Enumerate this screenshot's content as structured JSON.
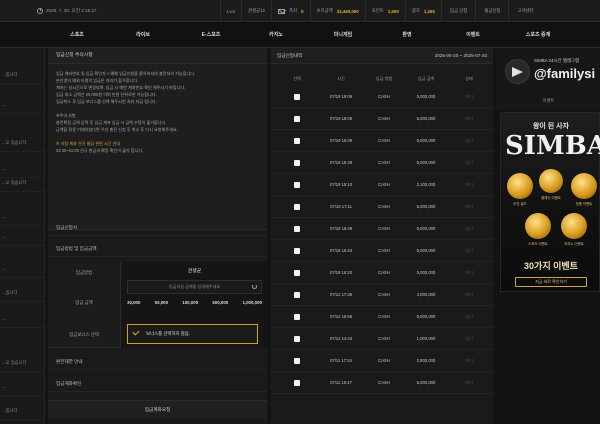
{
  "topbar": {
    "datetime": "2025. 7. 20. 오전 2:15:27",
    "level": "Lv.8",
    "username": "관생균12",
    "message_label": "쪽지",
    "message_count": "0",
    "money_label": "보유금액",
    "money_value": "23,450,000",
    "point_label": "포인트",
    "point_value": "1,000",
    "comp_label": "콤프",
    "comp_value": "1,250",
    "deposit_btn": "입금 신청",
    "withdraw_btn": "출금신청",
    "support_btn": "고객센터"
  },
  "nav": [
    "스포츠",
    "라이브",
    "E-스포츠",
    "카지노",
    "미니게임",
    "환영",
    "이벤트",
    "스포츠 중계"
  ],
  "sidebar": [
    "...입니다",
    "...",
    "...오 있습니다",
    "...",
    "...오 있습니다",
    "...",
    "...",
    "...",
    "...입니다",
    "...",
    "...오 있습니다",
    "...",
    "...입니다"
  ],
  "left": {
    "notice_title": "입금신청 주의사항",
    "notice_lines": [
      "입금 계좌번호 및 입금 확인자 > 예예 입금신청을 클릭하셔야 충전처리 가능합니다.",
      "본인명의 예외 타명의 입금은 처리가 불가합니다.",
      "계좌는 실시간으로 변경되며, 입금 시 매번 계좌번호 확인 해주시기 바랍니다.",
      "입금 최소 금액은 20,000원 이며 만원 단위로만 가능합니다.",
      "입금취소 후 입금 보너스를 선택 해주시면 처리 지급 됩니다."
    ],
    "notice_lines2": [
      "※주의 사항",
      "충전확정 금액 입력 후 입금 계좌 입금 시 금액 수정이 불가합니다.",
      "금액을 잘못 기재하셨다면 우선 충전 신청 후 취소 후 다시 요청해주세요."
    ],
    "notice_highlight": "※ 자정 계좌 선규 발급 관련 시간 안내",
    "notice_highlight2": "23:30~01:00 선규 발급과 확정 확인이 불가 합니다.",
    "section_deposit": "입금신청서",
    "section_method": "입금방법 및 입금금액",
    "label_method": "입금방법",
    "label_amount": "입금 금액",
    "label_bonus": "입금보너스 선택",
    "bank_name": "관생균",
    "amount_placeholder": "입금하실 금액을 입력해주세요",
    "amounts": [
      "30,000",
      "50,000",
      "100,000",
      "500,000",
      "1,000,000"
    ],
    "bonus_text": "보너스를 선택하지 않음.",
    "section_guide": "환전제한 안내",
    "section_confirm": "입금계좌확인",
    "submit": "입금계좌요청"
  },
  "history": {
    "title": "입금신청내역",
    "range": "2025-06-20 ~ 2025-07-20",
    "headers": [
      "선택",
      "시간",
      "입금 방법",
      "입금 금액",
      "상태"
    ],
    "rows": [
      {
        "time": "07/19 19:09",
        "method": "CASH",
        "amount": "5,000,000",
        "status": "대기"
      },
      {
        "time": "07/19 18:09",
        "method": "CASH",
        "amount": "5,000,000",
        "status": "대기"
      },
      {
        "time": "07/19 16:09",
        "method": "CASH",
        "amount": "5,000,000",
        "status": "대기"
      },
      {
        "time": "07/19 15:48",
        "method": "CASH",
        "amount": "5,000,000",
        "status": "대기"
      },
      {
        "time": "07/19 15:10",
        "method": "CASH",
        "amount": "2,100,000",
        "status": "대기"
      },
      {
        "time": "07/18 17:11",
        "method": "CASH",
        "amount": "5,000,000",
        "status": "대기"
      },
      {
        "time": "07/18 16:49",
        "method": "CASH",
        "amount": "5,000,000",
        "status": "대기"
      },
      {
        "time": "07/18 16:43",
        "method": "CASH",
        "amount": "5,000,000",
        "status": "대기"
      },
      {
        "time": "07/18 16:20",
        "method": "CASH",
        "amount": "5,000,000",
        "status": "대기"
      },
      {
        "time": "07/12 17:36",
        "method": "CASH",
        "amount": "4,000,000",
        "status": "대기"
      },
      {
        "time": "07/12 16:56",
        "method": "CASH",
        "amount": "5,000,000",
        "status": "대기"
      },
      {
        "time": "07/12 14:43",
        "method": "CASH",
        "amount": "1,000,000",
        "status": "대기"
      },
      {
        "time": "07/11 17:24",
        "method": "CASH",
        "amount": "2,800,000",
        "status": "대기"
      },
      {
        "time": "07/11 16:47",
        "method": "CASH",
        "amount": "5,000,000",
        "status": "대기"
      }
    ]
  },
  "right": {
    "tg_title": "SIMBA 24시간 텔레그램",
    "tg_handle": "@familysi",
    "tg_event": "이벤트",
    "promo_sub": "왕이 된 사자",
    "promo_title": "SIMBA",
    "coins": [
      "도전 골드",
      "클래식 이벤트",
      "첫충 이벤트",
      "스포츠 이벤트",
      "카지노 이벤트"
    ],
    "promo_bottom": "30가지 이벤트",
    "promo_btn": "지금 바로 확인하기"
  },
  "colors": {
    "accent": "#e6b422",
    "background": "#141414"
  }
}
